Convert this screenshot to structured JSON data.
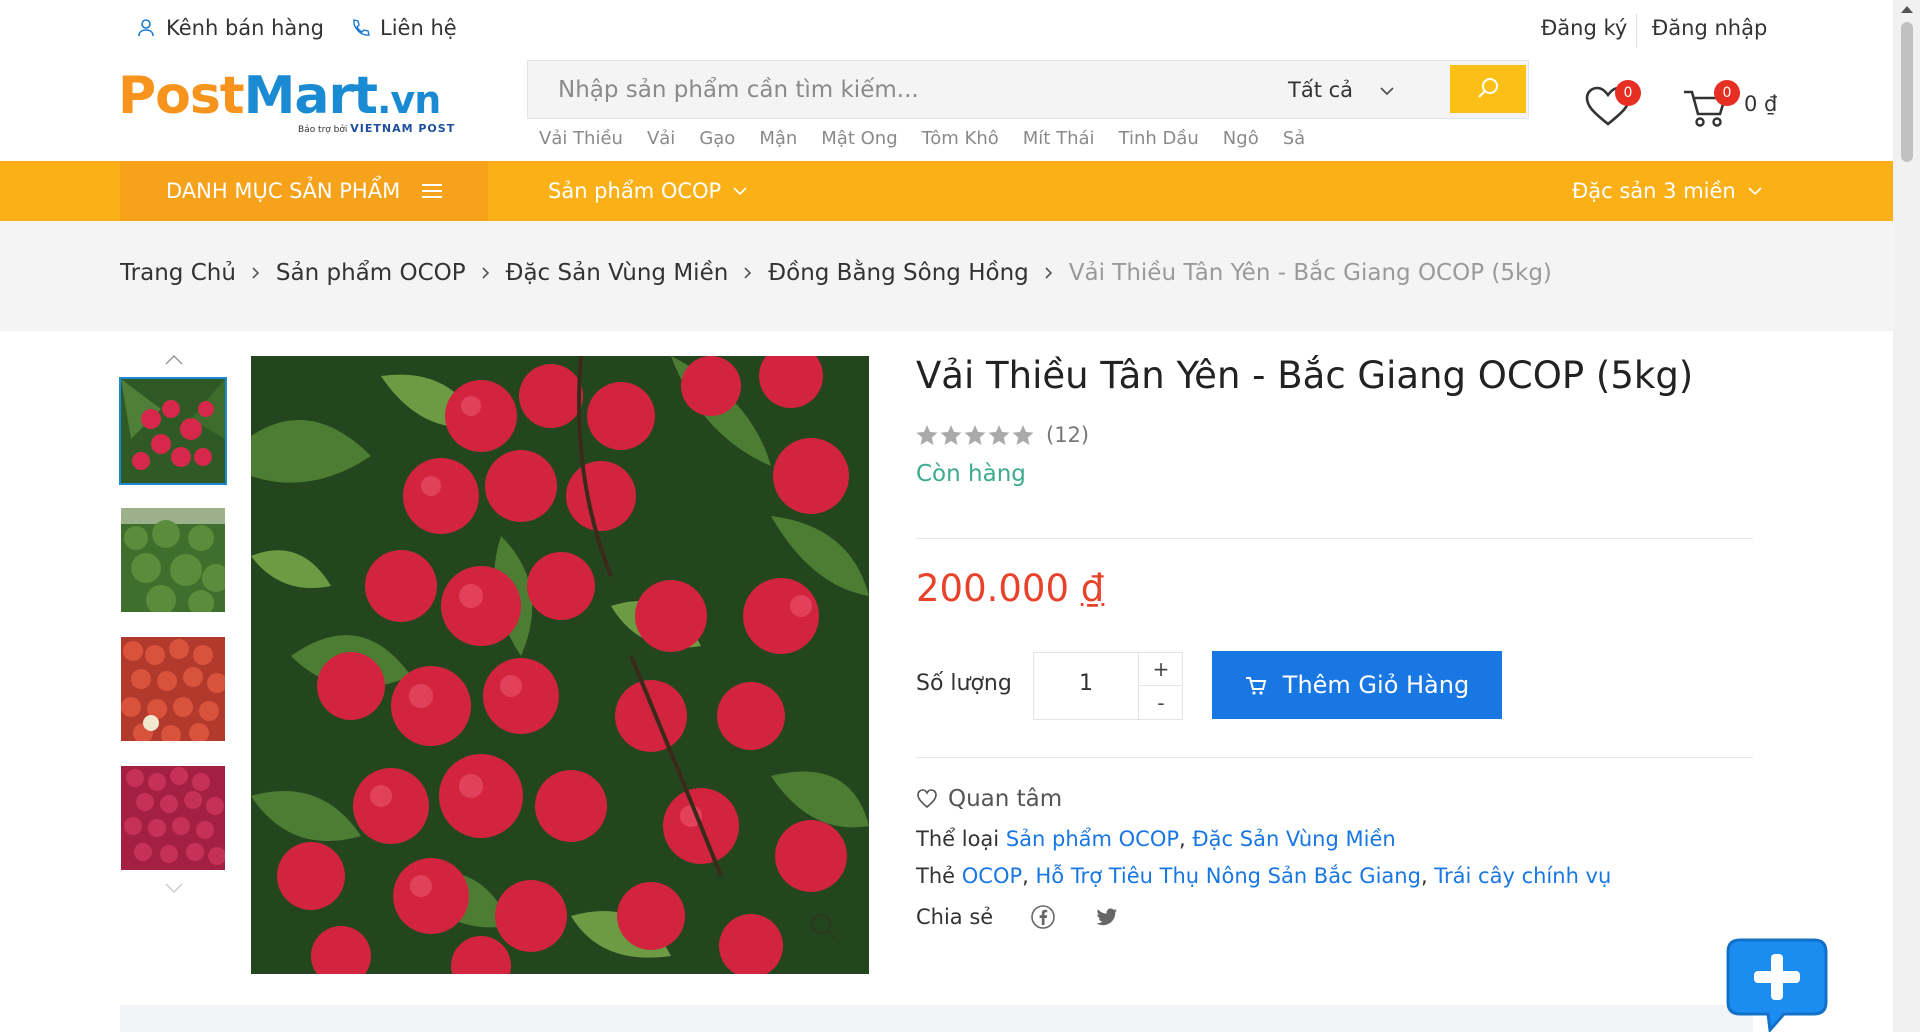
{
  "topbar": {
    "seller_link": "Kênh bán hàng",
    "contact_link": "Liên hệ",
    "register": "Đăng ký",
    "login": "Đăng nhập"
  },
  "logo": {
    "post": "Post",
    "mart": "Mart",
    "vn": ".vn",
    "tagline_prefix": "Bảo trợ bởi",
    "tagline_brand": "VIETNAM POST"
  },
  "search": {
    "placeholder": "Nhập sản phẩm cần tìm kiếm...",
    "category": "Tất cả",
    "suggestions": [
      "Vải Thiều",
      "Vải",
      "Gạo",
      "Mận",
      "Mật Ong",
      "Tôm Khô",
      "Mít Thái",
      "Tinh Dầu",
      "Ngô",
      "Sả"
    ]
  },
  "header": {
    "wishlist_count": "0",
    "cart_count": "0",
    "cart_total": "0 ₫"
  },
  "nav": {
    "categories_label": "DANH MỤC SẢN PHẨM",
    "ocop_label": "Sản phẩm OCOP",
    "regional_label": "Đặc sản 3 miền"
  },
  "breadcrumb": {
    "items": [
      "Trang Chủ",
      "Sản phẩm OCOP",
      "Đặc Sản Vùng Miền",
      "Đồng Bằng Sông Hồng"
    ],
    "current": "Vải Thiều Tân Yên - Bắc Giang OCOP (5kg)"
  },
  "product": {
    "title": "Vải Thiều Tân Yên - Bắc Giang OCOP (5kg)",
    "rating_stars": 0,
    "rating_count": "(12)",
    "stock": "Còn hàng",
    "price_value": "200.000",
    "price_currency": "₫",
    "quantity_label": "Số lượng",
    "quantity": "1",
    "plus": "+",
    "minus": "-",
    "add_to_cart": "Thêm Giỏ Hàng",
    "wishlist": "Quan tâm",
    "category_label": "Thể loại",
    "categories": [
      "Sản phẩm OCOP",
      "Đặc Sản Vùng Miền"
    ],
    "tags_label": "Thẻ",
    "tags": [
      "OCOP",
      "Hỗ Trợ Tiêu Thụ Nông Sản Bắc Giang",
      "Trái cây chính vụ"
    ],
    "share_label": "Chia sẻ"
  },
  "colors": {
    "brand_orange": "#fbb017",
    "brand_blue": "#1877e3",
    "price_red": "#e8432a",
    "stock_green": "#3cab8e"
  }
}
